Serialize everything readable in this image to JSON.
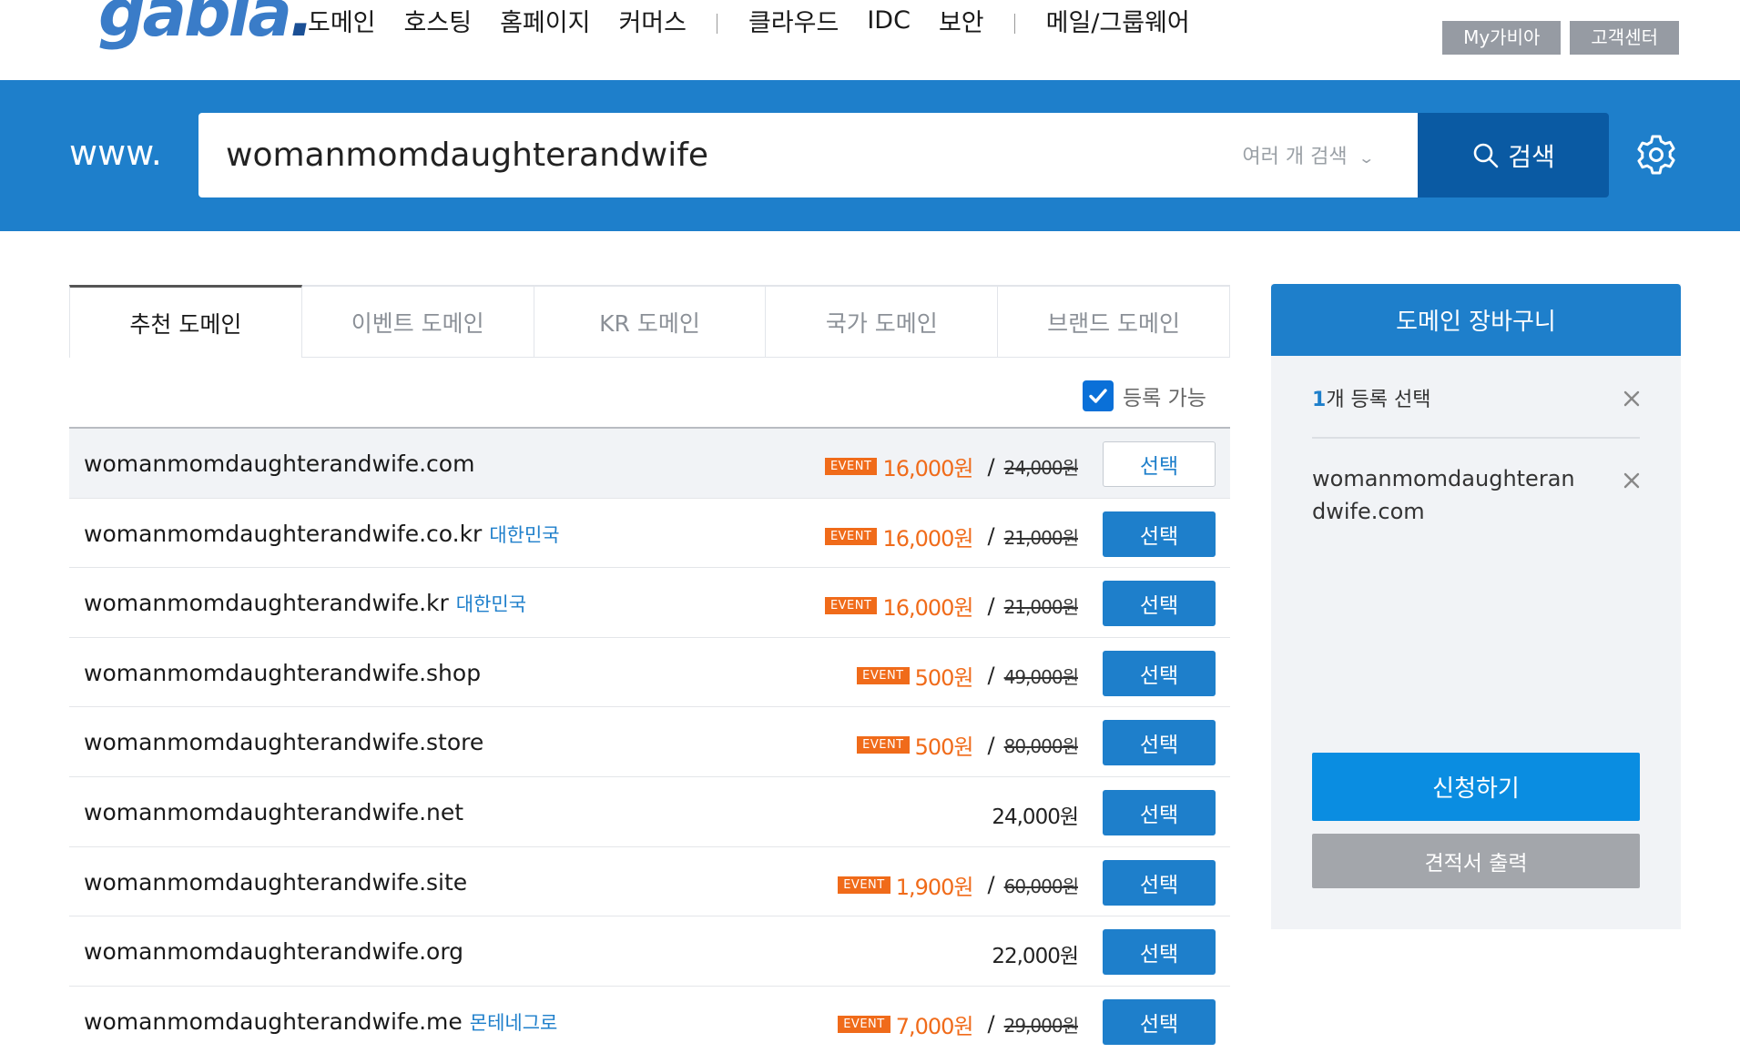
{
  "header": {
    "logo": "gabia",
    "nav": [
      "도메인",
      "호스팅",
      "홈페이지",
      "커머스",
      "클라우드",
      "IDC",
      "보안",
      "메일/그룹웨어"
    ],
    "top_buttons": [
      "My가비아",
      "고객센터"
    ]
  },
  "search": {
    "prefix": "www.",
    "query": "womanmomdaughterandwife",
    "multi_label": "여러 개 검색",
    "button_label": "검색"
  },
  "tabs": [
    "추천 도메인",
    "이벤트 도메인",
    "KR 도메인",
    "국가 도메인",
    "브랜드 도메인"
  ],
  "filter": {
    "label": "등록 가능",
    "checked": true
  },
  "event_badge": "EVENT",
  "select_label": "선택",
  "domains": [
    {
      "name": "womanmomdaughterandwife.com",
      "country": "",
      "event": true,
      "price": "16,000원",
      "old_price": "24,000원",
      "selected": true
    },
    {
      "name": "womanmomdaughterandwife.co.kr",
      "country": "대한민국",
      "event": true,
      "price": "16,000원",
      "old_price": "21,000원",
      "selected": false
    },
    {
      "name": "womanmomdaughterandwife.kr",
      "country": "대한민국",
      "event": true,
      "price": "16,000원",
      "old_price": "21,000원",
      "selected": false
    },
    {
      "name": "womanmomdaughterandwife.shop",
      "country": "",
      "event": true,
      "price": "500원",
      "old_price": "49,000원",
      "selected": false
    },
    {
      "name": "womanmomdaughterandwife.store",
      "country": "",
      "event": true,
      "price": "500원",
      "old_price": "80,000원",
      "selected": false
    },
    {
      "name": "womanmomdaughterandwife.net",
      "country": "",
      "event": false,
      "price": "24,000원",
      "old_price": "",
      "selected": false
    },
    {
      "name": "womanmomdaughterandwife.site",
      "country": "",
      "event": true,
      "price": "1,900원",
      "old_price": "60,000원",
      "selected": false
    },
    {
      "name": "womanmomdaughterandwife.org",
      "country": "",
      "event": false,
      "price": "22,000원",
      "old_price": "",
      "selected": false
    },
    {
      "name": "womanmomdaughterandwife.me",
      "country": "몬테네그로",
      "event": true,
      "price": "7,000원",
      "old_price": "29,000원",
      "selected": false
    }
  ],
  "cart": {
    "title": "도메인 장바구니",
    "count": "1",
    "count_suffix": "개 등록 선택",
    "items": [
      "womanmomdaughterandwife.com"
    ],
    "apply_label": "신청하기",
    "quote_label": "견적서 출력"
  },
  "colors": {
    "brand_blue": "#1e7fcb",
    "search_button": "#0a5aa3",
    "event_orange": "#f06b1a",
    "apply_button": "#0a8de1",
    "gray_button": "#a3a6ab"
  },
  "icons": {
    "search": "search-icon",
    "settings": "gear-icon",
    "close": "close-icon",
    "check": "check-icon",
    "dropdown": "chevron-down-icon"
  }
}
